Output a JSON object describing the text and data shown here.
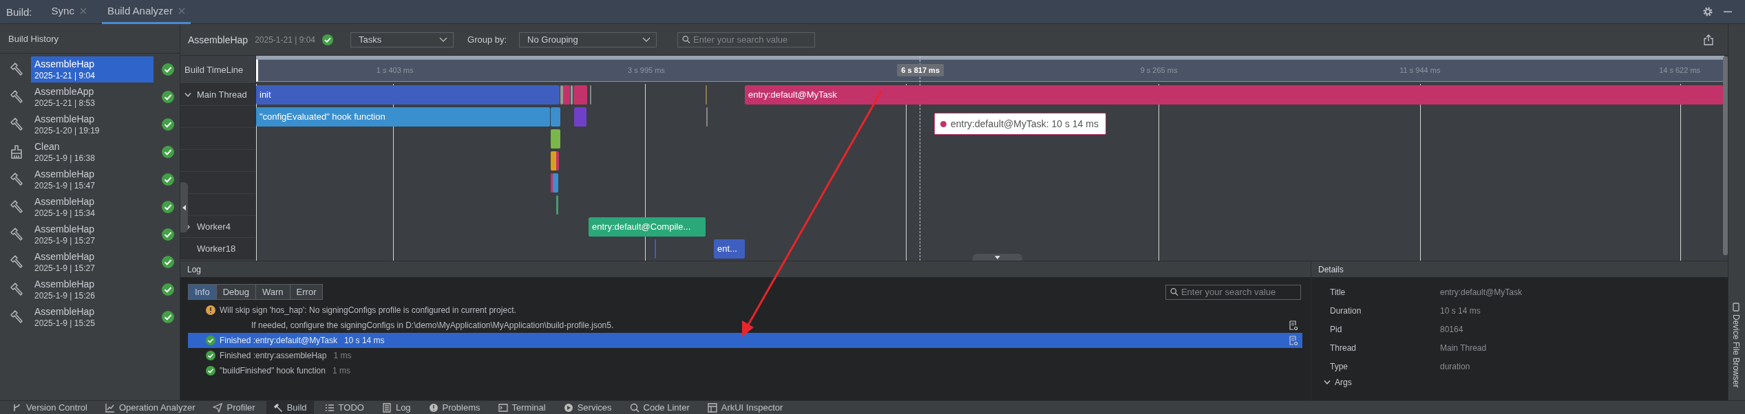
{
  "window": {
    "label": "Build:",
    "tabs": [
      {
        "label": "Sync",
        "selected": false
      },
      {
        "label": "Build Analyzer",
        "selected": true
      }
    ]
  },
  "build_history": {
    "title": "Build History",
    "items": [
      {
        "kind": "build",
        "name": "AssembleHap",
        "time": "2025-1-21 | 9:04",
        "selected": true
      },
      {
        "kind": "build",
        "name": "AssembleApp",
        "time": "2025-1-21 | 8:53",
        "selected": false
      },
      {
        "kind": "build",
        "name": "AssembleHap",
        "time": "2025-1-20 | 19:19",
        "selected": false
      },
      {
        "kind": "clean",
        "name": "Clean",
        "time": "2025-1-9 | 16:38",
        "selected": false
      },
      {
        "kind": "build",
        "name": "AssembleHap",
        "time": "2025-1-9 | 15:47",
        "selected": false
      },
      {
        "kind": "build",
        "name": "AssembleHap",
        "time": "2025-1-9 | 15:34",
        "selected": false
      },
      {
        "kind": "build",
        "name": "AssembleHap",
        "time": "2025-1-9 | 15:27",
        "selected": false
      },
      {
        "kind": "build",
        "name": "AssembleHap",
        "time": "2025-1-9 | 15:27",
        "selected": false
      },
      {
        "kind": "build",
        "name": "AssembleHap",
        "time": "2025-1-9 | 15:26",
        "selected": false
      },
      {
        "kind": "build",
        "name": "AssembleHap",
        "time": "2025-1-9 | 15:25",
        "selected": false
      }
    ]
  },
  "summary": {
    "name": "AssembleHap",
    "time": "2025-1-21 | 9:04"
  },
  "filters": {
    "view": "Tasks",
    "group_by_label": "Group by:",
    "group_by": "No Grouping",
    "search": {
      "placeholder": "Enter your search value"
    }
  },
  "timeline": {
    "title": "Build TimeLine",
    "ticks": [
      "1 s 403 ms",
      "3 s 995 ms",
      "9 s 265 ms",
      "11 s 944 ms",
      "14 s 622 ms"
    ],
    "cursor": "6 s 817 ms",
    "rows": [
      {
        "name": "Main Thread",
        "expanded": true,
        "bars": [
          {
            "label": "init",
            "color": "#3f5fc0"
          },
          {
            "label": "entry:default@MyTask",
            "color": "#c3336a"
          }
        ]
      },
      {
        "bars": [
          {
            "label": "\"configEvaluated\" hook function",
            "color": "#3a8fcf"
          }
        ]
      },
      {
        "name": "Worker4",
        "expanded": false,
        "bars": [
          {
            "label": "entry:default@Compile...",
            "color": "#2aa87a"
          }
        ]
      },
      {
        "name": "Worker18",
        "bars": [
          {
            "label": "ent...",
            "color": "#3f5fc0"
          }
        ]
      }
    ],
    "tooltip": "entry:default@MyTask: 10 s 14 ms"
  },
  "log": {
    "title": "Log",
    "levels": [
      {
        "label": "Info",
        "selected": true
      },
      {
        "label": "Debug",
        "selected": false
      },
      {
        "label": "Warn",
        "selected": false
      },
      {
        "label": "Error",
        "selected": false
      }
    ],
    "search": {
      "placeholder": "Enter your search value"
    },
    "lines": [
      {
        "kind": "warning",
        "text": "Will skip sign 'hos_hap': No signingConfigs profile is configured in current project.",
        "selected": false
      },
      {
        "kind": "detail",
        "text": "If needed, configure the signingConfigs in D:\\demo\\MyApplication\\MyApplication\\build-profile.json5.",
        "selected": false
      },
      {
        "kind": "success",
        "text": "Finished :entry:default@MyTask",
        "duration": "10 s 14 ms",
        "selected": true
      },
      {
        "kind": "success",
        "text": "Finished :entry:assembleHap",
        "duration": "1 ms",
        "selected": false
      },
      {
        "kind": "success",
        "text": "\"buildFinished\" hook function",
        "duration": "1 ms",
        "selected": false
      }
    ]
  },
  "details": {
    "title": "Details",
    "fields": [
      {
        "key": "Title",
        "value": "entry:default@MyTask"
      },
      {
        "key": "Duration",
        "value": "10 s 14 ms"
      },
      {
        "key": "Pid",
        "value": "80164"
      },
      {
        "key": "Thread",
        "value": "Main Thread"
      },
      {
        "key": "Type",
        "value": "duration"
      }
    ],
    "args": {
      "label": "Args",
      "expanded": true
    }
  },
  "side_tool": "Device File Browser",
  "tool_windows": [
    {
      "label": "Version Control",
      "selected": false
    },
    {
      "label": "Operation Analyzer",
      "selected": false
    },
    {
      "label": "Profiler",
      "selected": false
    },
    {
      "label": "Build",
      "selected": true
    },
    {
      "label": "TODO",
      "selected": false
    },
    {
      "label": "Log",
      "selected": false
    },
    {
      "label": "Problems",
      "selected": false
    },
    {
      "label": "Terminal",
      "selected": false
    },
    {
      "label": "Services",
      "selected": false
    },
    {
      "label": "Code Linter",
      "selected": false
    },
    {
      "label": "ArkUI Inspector",
      "selected": false
    }
  ]
}
